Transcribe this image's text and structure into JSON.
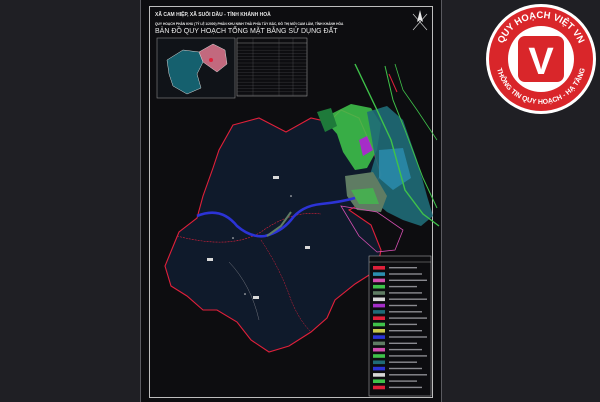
{
  "header": {
    "line1": "XÃ CAM HIỆP, XÃ SUỐI DẦU - TỈNH KHÁNH HOÀ",
    "line2": "QUY HOẠCH PHÂN KHU (TỶ LỆ 1/2000) PHÂN KHU NINH THẢI PHÍA TÂY BẮC, ĐÔ THỊ MỚI CAM LÂM, TỈNH KHÁNH HÒA",
    "map_title": "BẢN ĐỒ QUY HOẠCH TỔNG MẶT BẰNG SỬ DỤNG ĐẤT"
  },
  "logo": {
    "letter": "V",
    "top_text": "QUY HOẠCH VIỆT VN",
    "bottom_text": "THÔNG TIN QUY HOẠCH - HẠ TẦNG",
    "color": "#d9262a"
  },
  "colors": {
    "background": "#1f1f24",
    "sheet": "#0d0d10",
    "territory_fill": "#0f1a2b",
    "boundary": "#e0203a",
    "river": "#2c33d6",
    "green_zone": "#3fc24a",
    "urban_zone": "#1f6b78",
    "inset_left": "#15606e",
    "inset_right": "#c2697e"
  },
  "icons": {
    "compass": "north-arrow-icon"
  }
}
